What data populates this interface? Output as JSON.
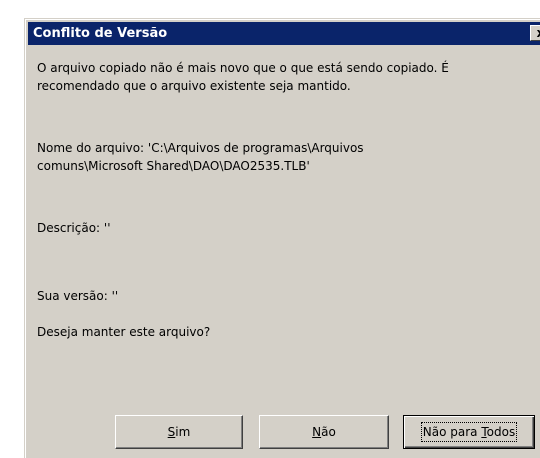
{
  "dialog": {
    "title": "Conflito de Versão",
    "close_label": "x",
    "message_line1": "O arquivo copiado não é mais novo que o que está sendo copiado. É",
    "message_line2": "recomendado que o arquivo existente seja mantido.",
    "filename_line1": "Nome do arquivo:    'C:\\Arquivos de programas\\Arquivos",
    "filename_line2": "comuns\\Microsoft Shared\\DAO\\DAO2535.TLB'",
    "description": "Descrição:  ''",
    "your_version": "Sua versão:  ''",
    "question": "Deseja manter este arquivo?"
  },
  "buttons": {
    "yes": {
      "mnemonic": "S",
      "rest": "im"
    },
    "no": {
      "mnemonic": "N",
      "rest": "ão"
    },
    "no_to_all": {
      "before": "Não para ",
      "mnemonic": "T",
      "rest": "odos"
    }
  }
}
